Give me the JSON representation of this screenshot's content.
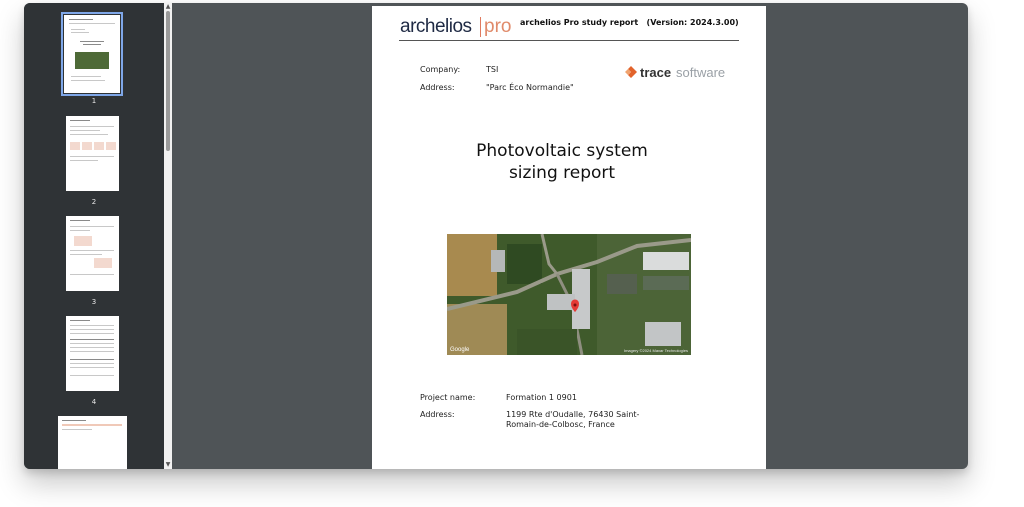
{
  "sidebar": {
    "thumbnails": [
      {
        "page": "1",
        "selected": true
      },
      {
        "page": "2",
        "selected": false
      },
      {
        "page": "3",
        "selected": false
      },
      {
        "page": "4",
        "selected": false
      }
    ]
  },
  "report": {
    "brand": "archelios",
    "brand_suffix": "pro",
    "header_title": "archelios Pro study report   (Version: 2024.3.00)",
    "company_label": "Company:",
    "company_value": "TSI",
    "address_label": "Address:",
    "address_value": "\"Parc Éco Normandie\"",
    "partner_logo_main": "trace",
    "partner_logo_sub": "software",
    "title_line1": "Photovoltaic system",
    "title_line2": "sizing report",
    "map_google": "Google",
    "map_credit": "Imagery ©2024 Maxar Technologies",
    "project_label": "Project name:",
    "project_value": "Formation 1 0901",
    "project_address_label": "Address:",
    "project_address_line1": "1199 Rte d'Oudalle, 76430 Saint-",
    "project_address_line2": "Romain-de-Colbosc, France"
  },
  "colors": {
    "sidebar_bg": "#2f3336",
    "viewer_bg": "#4f5457",
    "selection": "#7fa7e8",
    "brand_accent": "#e08a6a",
    "trace_orange": "#e2632b"
  },
  "icons": {
    "scroll_up": "▲",
    "scroll_down": "▼",
    "map_marker": "location-pin-icon"
  }
}
